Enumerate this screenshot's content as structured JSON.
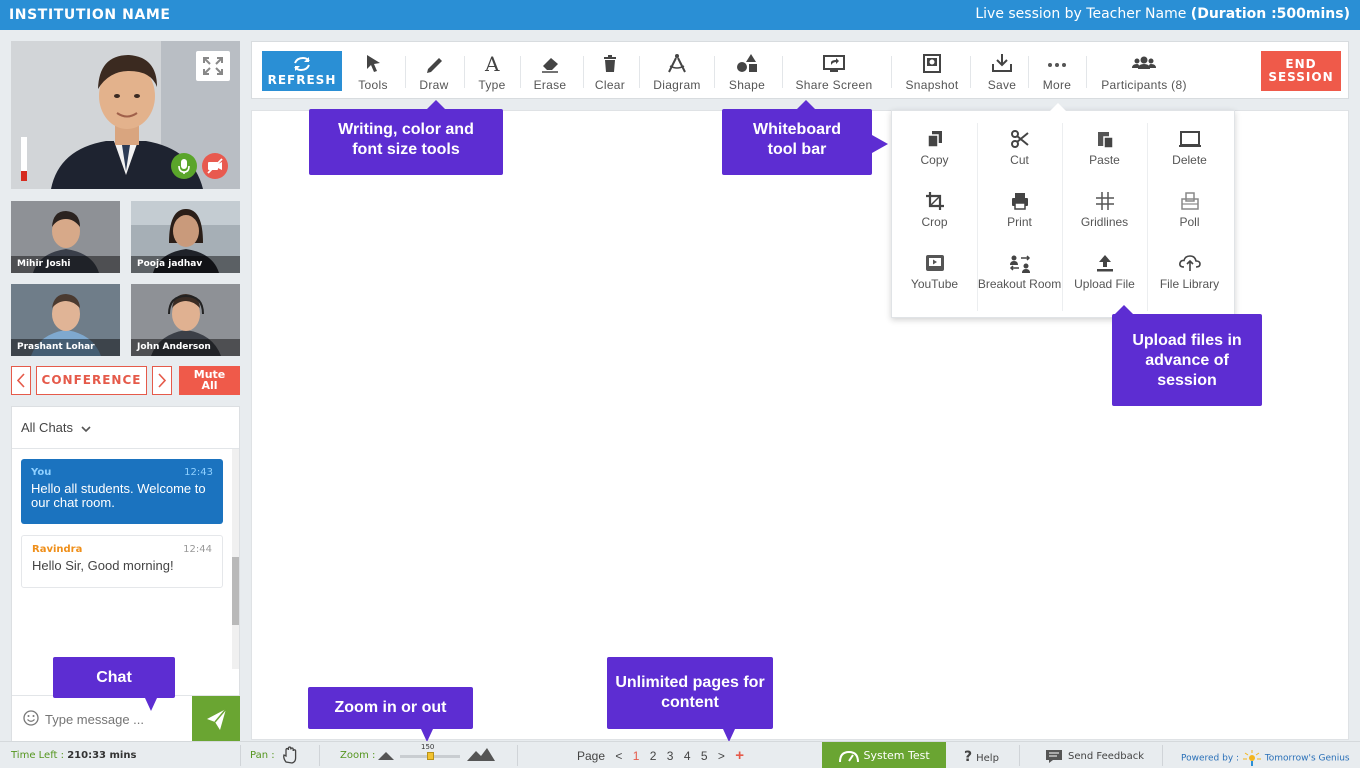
{
  "header": {
    "institution": "INSTITUTION NAME",
    "session_text": "Live session by Teacher Name",
    "duration": "(Duration :500mins)"
  },
  "participants_video": {
    "thumbs": [
      {
        "name": "Mihir Joshi",
        "bg": "#8d8f93"
      },
      {
        "name": "Pooja jadhav",
        "bg": "#9aa3ab"
      },
      {
        "name": "Prashant Lohar",
        "bg": "#6c7a86"
      },
      {
        "name": "John Anderson",
        "bg": "#8c8f93"
      }
    ]
  },
  "conference": {
    "label": "CONFERENCE",
    "mute_line1": "Mute",
    "mute_line2": "All"
  },
  "chat": {
    "filter": "All Chats",
    "messages": [
      {
        "who": "You",
        "time": "12:43",
        "text": "Hello all students. Welcome to our chat room."
      },
      {
        "who": "Ravindra",
        "time": "12:44",
        "text": "Hello Sir, Good morning!"
      }
    ],
    "placeholder": "Type message ..."
  },
  "toolbar": {
    "refresh": "REFRESH",
    "tools": [
      "Tools",
      "Draw",
      "Type",
      "Erase",
      "Clear",
      "Diagram",
      "Shape",
      "Share Screen",
      "Snapshot",
      "Save",
      "More",
      "Participants (8)"
    ],
    "end_line1": "END",
    "end_line2": "SESSION"
  },
  "more_menu": {
    "items": [
      "Copy",
      "Cut",
      "Paste",
      "Delete",
      "Crop",
      "Print",
      "Gridlines",
      "Poll",
      "YouTube",
      "Breakout Room",
      "Upload File",
      "File Library"
    ]
  },
  "callouts": {
    "writing": "Writing, color and font size tools",
    "whiteboard": "Whiteboard tool bar",
    "upload": "Upload files in advance of session",
    "chat": "Chat",
    "zoom": "Zoom in or out",
    "pages": "Unlimited pages for content"
  },
  "footer": {
    "time_left_label": "Time Left :",
    "time_left_value": "210:33 mins",
    "pan": "Pan :",
    "zoom": "Zoom :",
    "zoom_value": "150",
    "page_label": "Page",
    "pages": [
      "1",
      "2",
      "3",
      "4",
      "5"
    ],
    "system_test": "System Test",
    "help": "Help",
    "feedback": "Send Feedback",
    "powered_by": "Powered by :",
    "brand": "Tomorrow's Genius"
  },
  "colors": {
    "header_blue": "#2a8fd5",
    "accent_red": "#ef5a4a",
    "callout_purple": "#5d2dd2",
    "green": "#6aa532"
  }
}
